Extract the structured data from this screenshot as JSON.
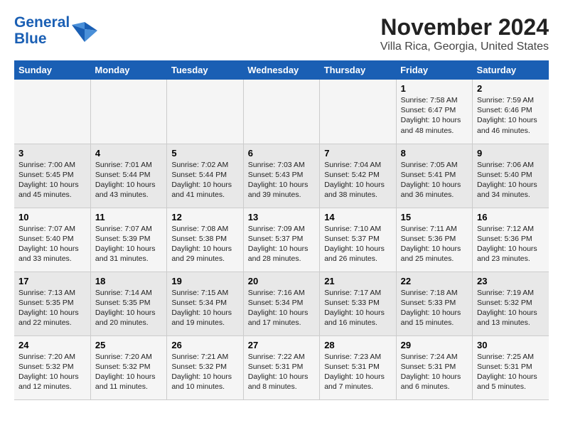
{
  "logo": {
    "text_general": "General",
    "text_blue": "Blue"
  },
  "title": "November 2024",
  "subtitle": "Villa Rica, Georgia, United States",
  "headers": [
    "Sunday",
    "Monday",
    "Tuesday",
    "Wednesday",
    "Thursday",
    "Friday",
    "Saturday"
  ],
  "weeks": [
    [
      {
        "day": "",
        "info": ""
      },
      {
        "day": "",
        "info": ""
      },
      {
        "day": "",
        "info": ""
      },
      {
        "day": "",
        "info": ""
      },
      {
        "day": "",
        "info": ""
      },
      {
        "day": "1",
        "info": "Sunrise: 7:58 AM\nSunset: 6:47 PM\nDaylight: 10 hours and 48 minutes."
      },
      {
        "day": "2",
        "info": "Sunrise: 7:59 AM\nSunset: 6:46 PM\nDaylight: 10 hours and 46 minutes."
      }
    ],
    [
      {
        "day": "3",
        "info": "Sunrise: 7:00 AM\nSunset: 5:45 PM\nDaylight: 10 hours and 45 minutes."
      },
      {
        "day": "4",
        "info": "Sunrise: 7:01 AM\nSunset: 5:44 PM\nDaylight: 10 hours and 43 minutes."
      },
      {
        "day": "5",
        "info": "Sunrise: 7:02 AM\nSunset: 5:44 PM\nDaylight: 10 hours and 41 minutes."
      },
      {
        "day": "6",
        "info": "Sunrise: 7:03 AM\nSunset: 5:43 PM\nDaylight: 10 hours and 39 minutes."
      },
      {
        "day": "7",
        "info": "Sunrise: 7:04 AM\nSunset: 5:42 PM\nDaylight: 10 hours and 38 minutes."
      },
      {
        "day": "8",
        "info": "Sunrise: 7:05 AM\nSunset: 5:41 PM\nDaylight: 10 hours and 36 minutes."
      },
      {
        "day": "9",
        "info": "Sunrise: 7:06 AM\nSunset: 5:40 PM\nDaylight: 10 hours and 34 minutes."
      }
    ],
    [
      {
        "day": "10",
        "info": "Sunrise: 7:07 AM\nSunset: 5:40 PM\nDaylight: 10 hours and 33 minutes."
      },
      {
        "day": "11",
        "info": "Sunrise: 7:07 AM\nSunset: 5:39 PM\nDaylight: 10 hours and 31 minutes."
      },
      {
        "day": "12",
        "info": "Sunrise: 7:08 AM\nSunset: 5:38 PM\nDaylight: 10 hours and 29 minutes."
      },
      {
        "day": "13",
        "info": "Sunrise: 7:09 AM\nSunset: 5:37 PM\nDaylight: 10 hours and 28 minutes."
      },
      {
        "day": "14",
        "info": "Sunrise: 7:10 AM\nSunset: 5:37 PM\nDaylight: 10 hours and 26 minutes."
      },
      {
        "day": "15",
        "info": "Sunrise: 7:11 AM\nSunset: 5:36 PM\nDaylight: 10 hours and 25 minutes."
      },
      {
        "day": "16",
        "info": "Sunrise: 7:12 AM\nSunset: 5:36 PM\nDaylight: 10 hours and 23 minutes."
      }
    ],
    [
      {
        "day": "17",
        "info": "Sunrise: 7:13 AM\nSunset: 5:35 PM\nDaylight: 10 hours and 22 minutes."
      },
      {
        "day": "18",
        "info": "Sunrise: 7:14 AM\nSunset: 5:35 PM\nDaylight: 10 hours and 20 minutes."
      },
      {
        "day": "19",
        "info": "Sunrise: 7:15 AM\nSunset: 5:34 PM\nDaylight: 10 hours and 19 minutes."
      },
      {
        "day": "20",
        "info": "Sunrise: 7:16 AM\nSunset: 5:34 PM\nDaylight: 10 hours and 17 minutes."
      },
      {
        "day": "21",
        "info": "Sunrise: 7:17 AM\nSunset: 5:33 PM\nDaylight: 10 hours and 16 minutes."
      },
      {
        "day": "22",
        "info": "Sunrise: 7:18 AM\nSunset: 5:33 PM\nDaylight: 10 hours and 15 minutes."
      },
      {
        "day": "23",
        "info": "Sunrise: 7:19 AM\nSunset: 5:32 PM\nDaylight: 10 hours and 13 minutes."
      }
    ],
    [
      {
        "day": "24",
        "info": "Sunrise: 7:20 AM\nSunset: 5:32 PM\nDaylight: 10 hours and 12 minutes."
      },
      {
        "day": "25",
        "info": "Sunrise: 7:20 AM\nSunset: 5:32 PM\nDaylight: 10 hours and 11 minutes."
      },
      {
        "day": "26",
        "info": "Sunrise: 7:21 AM\nSunset: 5:32 PM\nDaylight: 10 hours and 10 minutes."
      },
      {
        "day": "27",
        "info": "Sunrise: 7:22 AM\nSunset: 5:31 PM\nDaylight: 10 hours and 8 minutes."
      },
      {
        "day": "28",
        "info": "Sunrise: 7:23 AM\nSunset: 5:31 PM\nDaylight: 10 hours and 7 minutes."
      },
      {
        "day": "29",
        "info": "Sunrise: 7:24 AM\nSunset: 5:31 PM\nDaylight: 10 hours and 6 minutes."
      },
      {
        "day": "30",
        "info": "Sunrise: 7:25 AM\nSunset: 5:31 PM\nDaylight: 10 hours and 5 minutes."
      }
    ]
  ]
}
